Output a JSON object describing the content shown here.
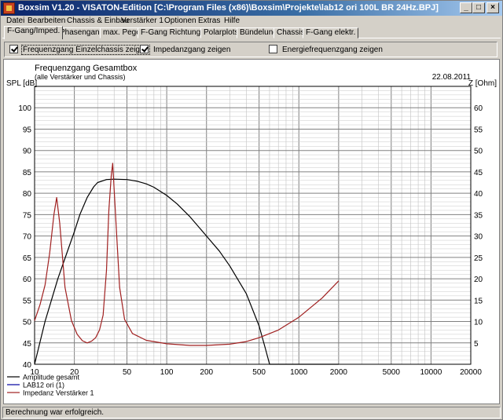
{
  "window": {
    "title": "Boxsim V1.20 - VISATON-Edition [C:\\Program Files (x86)\\Boxsim\\Projekte\\lab12 ori 100L BR 24Hz.BPJ]",
    "controls": [
      "_",
      "□",
      "×"
    ]
  },
  "menu": [
    "Datei",
    "Bearbeiten",
    "Chassis & Einbau",
    "Verstärker 1",
    "Optionen",
    "Extras",
    "Hilfe"
  ],
  "tabs": [
    {
      "label": "F-Gang/Imped.",
      "active": true
    },
    {
      "label": "Phasengang"
    },
    {
      "label": "max. Pegel"
    },
    {
      "label": "F-Gang Richtungen"
    },
    {
      "label": "Polarplots"
    },
    {
      "label": "Bündelung"
    },
    {
      "label": "Chassis"
    },
    {
      "label": "F-Gang elektr."
    }
  ],
  "options": [
    {
      "label": "Frequenzgang Einzelchassis zeigen",
      "checked": true
    },
    {
      "label": "Impedanzgang zeigen",
      "checked": true
    },
    {
      "label": "Energiefrequenzgang zeigen",
      "checked": false
    }
  ],
  "status": "Berechnung war erfolgreich.",
  "chart_data": {
    "type": "line",
    "title": "Frequenzgang Gesamtbox",
    "subtitle": "(alle Verstärker und Chassis)",
    "date": "22.08.2011",
    "ylabel_left": "SPL [dB]",
    "ylabel_right": "Z [Ohm]",
    "x_scale": "log",
    "xlim": [
      10,
      20000
    ],
    "ylim_left": [
      40,
      105
    ],
    "ylim_right": [
      0,
      65
    ],
    "x_ticks": [
      10,
      20,
      50,
      100,
      200,
      500,
      1000,
      2000,
      5000,
      10000,
      20000
    ],
    "x_tick_labels": [
      "10",
      "20",
      "50",
      "100",
      "200",
      "500",
      "1000",
      "2000",
      "5000",
      "10000",
      "20000"
    ],
    "y_left_ticks": [
      40,
      45,
      50,
      55,
      60,
      65,
      70,
      75,
      80,
      85,
      90,
      95,
      100,
      105
    ],
    "y_right_ticks": [
      5,
      10,
      15,
      20,
      25,
      30,
      35,
      40,
      45,
      50,
      55,
      60,
      65
    ],
    "grid": true,
    "legend_position": "bottom-left",
    "series": [
      {
        "name": "Amplitude gesamt",
        "axis": "left",
        "color": "#000000",
        "x": [
          10,
          12,
          15,
          18,
          20,
          22,
          25,
          28,
          30,
          35,
          40,
          50,
          60,
          70,
          80,
          100,
          120,
          150,
          200,
          250,
          300,
          400,
          500,
          560,
          600,
          1000,
          2000
        ],
        "y": [
          40,
          50,
          60,
          67,
          71,
          75,
          79,
          81.5,
          82.5,
          83.2,
          83.3,
          83.2,
          82.8,
          82.2,
          81.4,
          79.5,
          77.5,
          74.5,
          70,
          66.5,
          63,
          56.5,
          49,
          43.5,
          39.8,
          39.8,
          39.8
        ]
      },
      {
        "name": "LAB12 ori (1)",
        "axis": "left",
        "color": "#0000a0",
        "x": [],
        "y": []
      },
      {
        "name": "Impedanz Verstärker 1",
        "axis": "right",
        "color": "#a02020",
        "x": [
          10,
          11,
          12,
          13,
          14,
          14.7,
          15.5,
          17,
          19,
          21,
          23,
          25,
          27,
          29,
          31,
          33,
          35,
          36.5,
          38,
          39,
          41,
          44,
          48,
          55,
          70,
          100,
          150,
          200,
          300,
          400,
          500,
          700,
          1000,
          1500,
          2000
        ],
        "y": [
          10.2,
          14,
          18.5,
          26,
          35,
          39,
          33,
          18,
          10.2,
          7,
          5.5,
          5,
          5.4,
          6.2,
          8,
          11.5,
          22,
          36,
          44,
          47,
          35,
          18,
          10.5,
          7.2,
          5.6,
          4.8,
          4.4,
          4.4,
          4.7,
          5.3,
          6.2,
          8,
          11,
          15.5,
          19.5
        ]
      }
    ]
  }
}
